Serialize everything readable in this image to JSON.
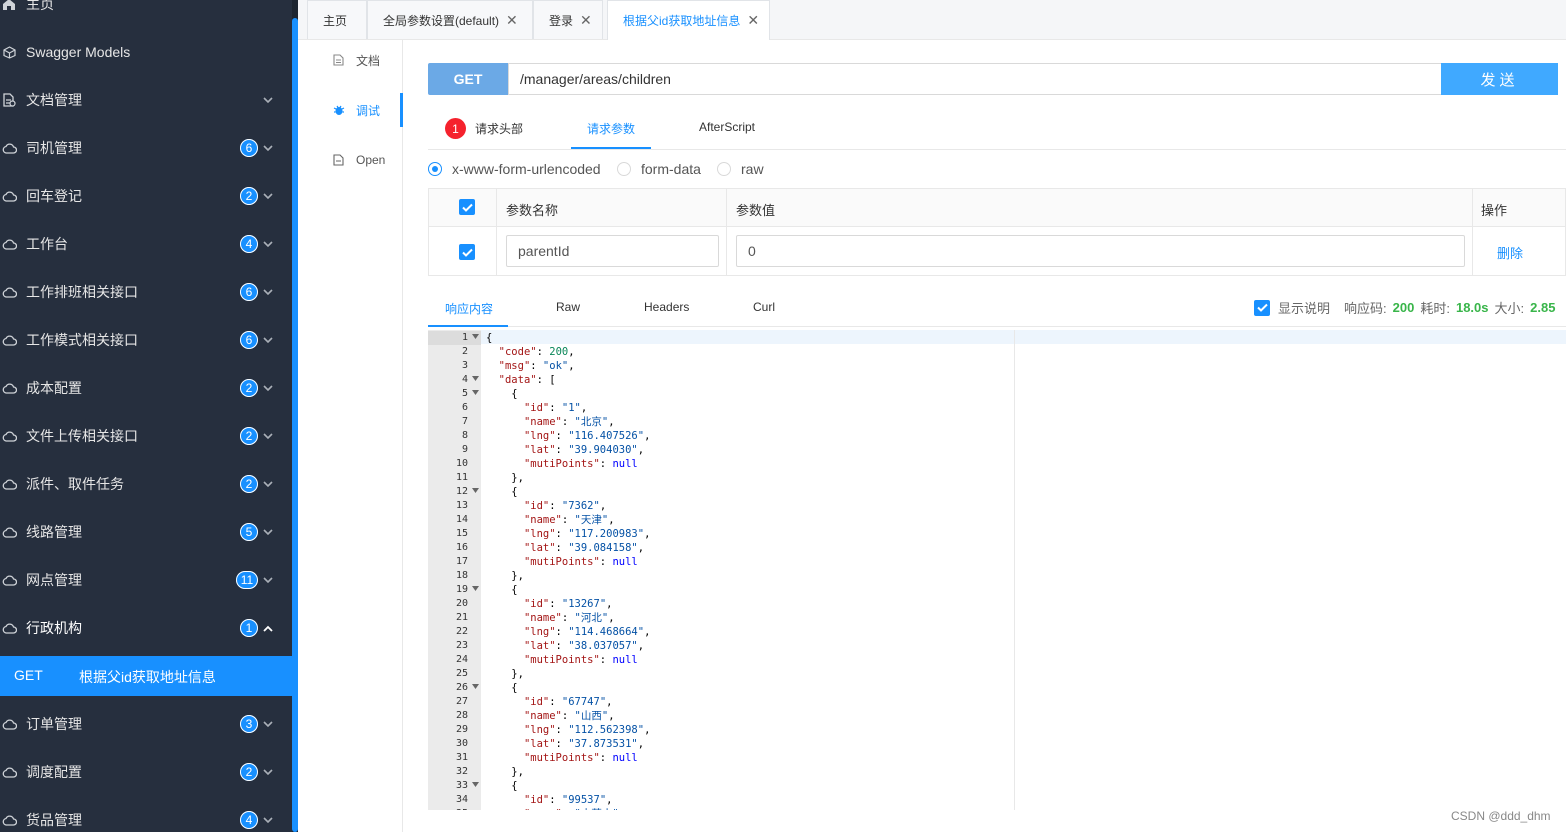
{
  "sidebar": {
    "items": [
      {
        "label": "主页",
        "icon": "home-icon",
        "badge": "",
        "chev": false
      },
      {
        "label": "Swagger Models",
        "icon": "cube-icon",
        "badge": "",
        "chev": false
      },
      {
        "label": "文档管理",
        "icon": "doc-icon",
        "badge": "",
        "chev": true
      },
      {
        "label": "司机管理",
        "icon": "cloud-icon",
        "badge": "6",
        "chev": true
      },
      {
        "label": "回车登记",
        "icon": "cloud-icon",
        "badge": "2",
        "chev": true
      },
      {
        "label": "工作台",
        "icon": "cloud-icon",
        "badge": "4",
        "chev": true
      },
      {
        "label": "工作排班相关接口",
        "icon": "cloud-icon",
        "badge": "6",
        "chev": true
      },
      {
        "label": "工作模式相关接口",
        "icon": "cloud-icon",
        "badge": "6",
        "chev": true
      },
      {
        "label": "成本配置",
        "icon": "cloud-icon",
        "badge": "2",
        "chev": true
      },
      {
        "label": "文件上传相关接口",
        "icon": "cloud-icon",
        "badge": "2",
        "chev": true
      },
      {
        "label": "派件、取件任务",
        "icon": "cloud-icon",
        "badge": "2",
        "chev": true
      },
      {
        "label": "线路管理",
        "icon": "cloud-icon",
        "badge": "5",
        "chev": true
      },
      {
        "label": "网点管理",
        "icon": "cloud-icon",
        "badge": "11",
        "chev": true
      },
      {
        "label": "行政机构",
        "icon": "cloud-icon",
        "badge": "1",
        "chev": true,
        "expanded": true
      },
      {
        "label": "订单管理",
        "icon": "cloud-icon",
        "badge": "3",
        "chev": true
      },
      {
        "label": "调度配置",
        "icon": "cloud-icon",
        "badge": "2",
        "chev": true
      },
      {
        "label": "货品管理",
        "icon": "cloud-icon",
        "badge": "4",
        "chev": true
      }
    ],
    "active_operation": {
      "method": "GET",
      "title": "根据父id获取地址信息"
    }
  },
  "tabs": [
    {
      "label": "主页",
      "closable": false
    },
    {
      "label": "全局参数设置(default)",
      "closable": true
    },
    {
      "label": "登录",
      "closable": true
    },
    {
      "label": "根据父id获取地址信息",
      "closable": true,
      "active": true
    }
  ],
  "docmenu": [
    {
      "label": "文档",
      "icon": "document-icon"
    },
    {
      "label": "调试",
      "icon": "bug-icon",
      "active": true
    },
    {
      "label": "Open",
      "icon": "file-icon"
    }
  ],
  "request": {
    "method": "GET",
    "url": "/manager/areas/children",
    "send_label": "发送",
    "tabs": {
      "headers": "请求头部",
      "headers_badge": "1",
      "params": "请求参数",
      "afterscript": "AfterScript"
    },
    "content_types": [
      "x-www-form-urlencoded",
      "form-data",
      "raw"
    ],
    "selected_content_type": "x-www-form-urlencoded",
    "table": {
      "col_name": "参数名称",
      "col_value": "参数值",
      "col_action": "操作",
      "rows": [
        {
          "name": "parentId",
          "value": "0",
          "action": "删除"
        }
      ]
    }
  },
  "response": {
    "tabs": [
      "响应内容",
      "Raw",
      "Headers",
      "Curl"
    ],
    "show_desc_label": "显示说明",
    "code_label": "响应码:",
    "code": "200",
    "time_label": "耗时:",
    "time": "18.0s",
    "size_label": "大小:",
    "size": "2.85"
  },
  "watermark": "CSDN @ddd_dhm",
  "colors": {
    "accent": "#1890ff",
    "sidebar_bg": "#262f3e",
    "badge_red": "#f5222d",
    "ok_green": "#39b54a"
  }
}
